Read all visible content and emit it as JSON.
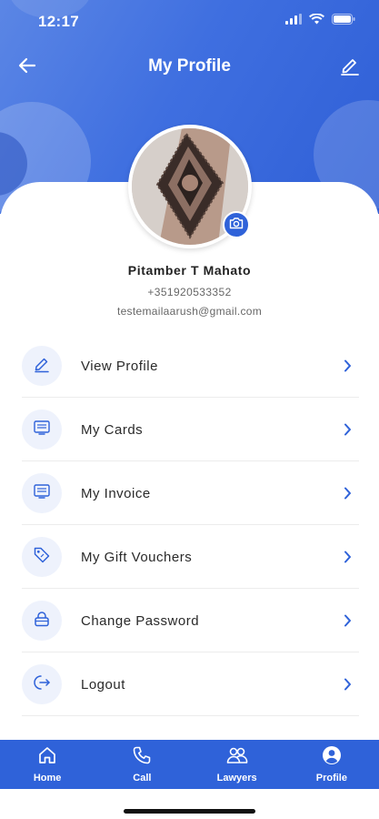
{
  "statusbar": {
    "time": "12:17"
  },
  "header": {
    "title": "My Profile"
  },
  "profile": {
    "name": "Pitamber T Mahato",
    "phone": "+351920533352",
    "email": "testemailaarush@gmail.com"
  },
  "menu": [
    {
      "label": "View Profile",
      "icon": "pencil-icon"
    },
    {
      "label": "My Cards",
      "icon": "card-icon"
    },
    {
      "label": "My Invoice",
      "icon": "invoice-icon"
    },
    {
      "label": "My Gift Vouchers",
      "icon": "tag-icon"
    },
    {
      "label": "Change Password",
      "icon": "lock-icon"
    },
    {
      "label": "Logout",
      "icon": "logout-icon"
    }
  ],
  "tabs": [
    {
      "label": "Home",
      "icon": "home-icon"
    },
    {
      "label": "Call",
      "icon": "phone-icon"
    },
    {
      "label": "Lawyers",
      "icon": "users-icon"
    },
    {
      "label": "Profile",
      "icon": "user-circle-icon"
    }
  ],
  "colors": {
    "primary": "#2f62d9",
    "icon_bg": "#eef2fc"
  }
}
